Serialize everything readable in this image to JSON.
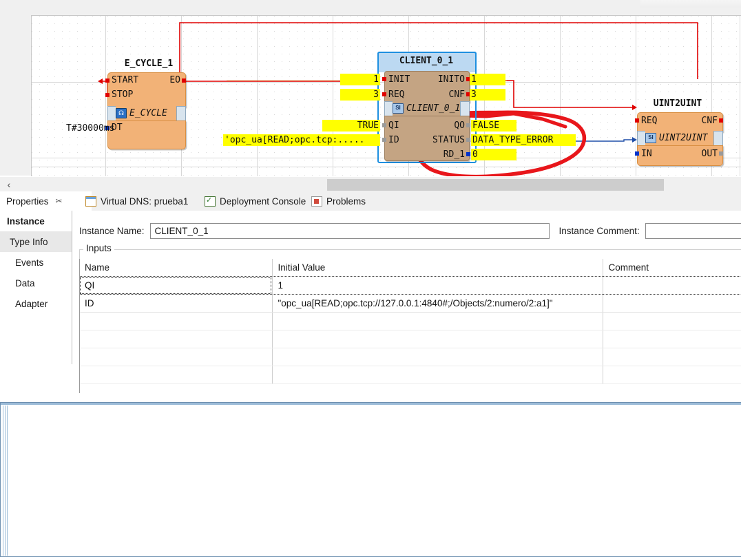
{
  "canvas": {
    "blocks": [
      {
        "id": "e_cycle_1",
        "title": "E_CYCLE_1",
        "type_name": "E_CYCLE",
        "type_icon": "cycle-icon",
        "event_inputs": [
          "START",
          "STOP"
        ],
        "event_outputs": [
          "EO"
        ],
        "data_inputs": [
          "DT"
        ],
        "data_outputs": [],
        "input_literals": [
          {
            "pin": "DT",
            "value": "T#30000ms"
          }
        ]
      },
      {
        "id": "client_0_1",
        "title": "CLIENT_0_1",
        "type_name": "CLIENT_0_1",
        "type_icon": "si-icon",
        "selected": true,
        "event_inputs": [
          "INIT",
          "REQ"
        ],
        "event_outputs": [
          "INITO",
          "CNF"
        ],
        "data_inputs": [
          "QI",
          "ID"
        ],
        "data_outputs": [
          "QO",
          "STATUS",
          "RD_1"
        ],
        "monitor_values": [
          {
            "pin": "INIT",
            "value": "1",
            "side": "left"
          },
          {
            "pin": "REQ",
            "value": "3",
            "side": "left"
          },
          {
            "pin": "INITO",
            "value": "1",
            "side": "right"
          },
          {
            "pin": "CNF",
            "value": "3",
            "side": "right"
          },
          {
            "pin": "QI",
            "value": "TRUE",
            "side": "left"
          },
          {
            "pin": "ID",
            "value": "'opc_ua[READ;opc.tcp:.....",
            "side": "left"
          },
          {
            "pin": "QO",
            "value": "FALSE",
            "side": "right"
          },
          {
            "pin": "STATUS",
            "value": "DATA_TYPE_ERROR",
            "side": "right"
          },
          {
            "pin": "RD_1",
            "value": "0",
            "side": "right"
          }
        ]
      },
      {
        "id": "uint2uint",
        "title": "UINT2UINT",
        "type_name": "UINT2UINT",
        "type_icon": "si-icon",
        "event_inputs": [
          "REQ"
        ],
        "event_outputs": [
          "CNF"
        ],
        "data_inputs": [
          "IN"
        ],
        "data_outputs": [
          "OUT"
        ]
      }
    ],
    "annotation": {
      "name": "red-ink-ellipse",
      "description": "hand-drawn red ellipse around QO / STATUS / RD_1 values"
    },
    "colors": {
      "block_fill": "#f2b277",
      "block_selected_fill": "#c4a483",
      "selection_outline": "#1d8fe0",
      "selection_header": "#bcd9f2",
      "event_wire": "#e00000",
      "data_wire": "#1f4fa8",
      "monitor_highlight": "#ffff00",
      "annotation_ink": "#e8161b"
    }
  },
  "scrollbar": {
    "left_arrow": "‹"
  },
  "tabs": [
    {
      "id": "properties",
      "label": "Properties",
      "icon": "properties-icon",
      "active": true,
      "closable": true,
      "close_glyph": "✂"
    },
    {
      "id": "virtual-dns",
      "label": "Virtual DNS: prueba1",
      "icon": "virtual-dns-icon",
      "active": false
    },
    {
      "id": "deployment-console",
      "label": "Deployment Console",
      "icon": "deployment-console-icon",
      "active": false
    },
    {
      "id": "problems",
      "label": "Problems",
      "icon": "problems-icon",
      "active": false
    }
  ],
  "properties": {
    "sidebar": [
      {
        "id": "instance",
        "label": "Instance",
        "selected": true
      },
      {
        "id": "type-info",
        "label": "Type Info",
        "hovered": true
      },
      {
        "id": "events",
        "label": "Events"
      },
      {
        "id": "data",
        "label": "Data"
      },
      {
        "id": "adapter",
        "label": "Adapter"
      }
    ],
    "instance_name_label": "Instance Name:",
    "instance_name_value": "CLIENT_0_1",
    "instance_comment_label": "Instance Comment:",
    "instance_comment_value": "",
    "inputs_group_label": "Inputs",
    "table": {
      "columns": [
        "Name",
        "Initial Value",
        "Comment"
      ],
      "rows": [
        {
          "name": "QI",
          "initial_value": "1",
          "comment": ""
        },
        {
          "name": "ID",
          "initial_value": "\"opc_ua[READ;opc.tcp://127.0.0.1:4840#;/Objects/2:numero/2:a1]\"",
          "comment": ""
        },
        {
          "name": "",
          "initial_value": "",
          "comment": ""
        },
        {
          "name": "",
          "initial_value": "",
          "comment": ""
        },
        {
          "name": "",
          "initial_value": "",
          "comment": ""
        },
        {
          "name": "",
          "initial_value": "",
          "comment": ""
        }
      ]
    }
  }
}
